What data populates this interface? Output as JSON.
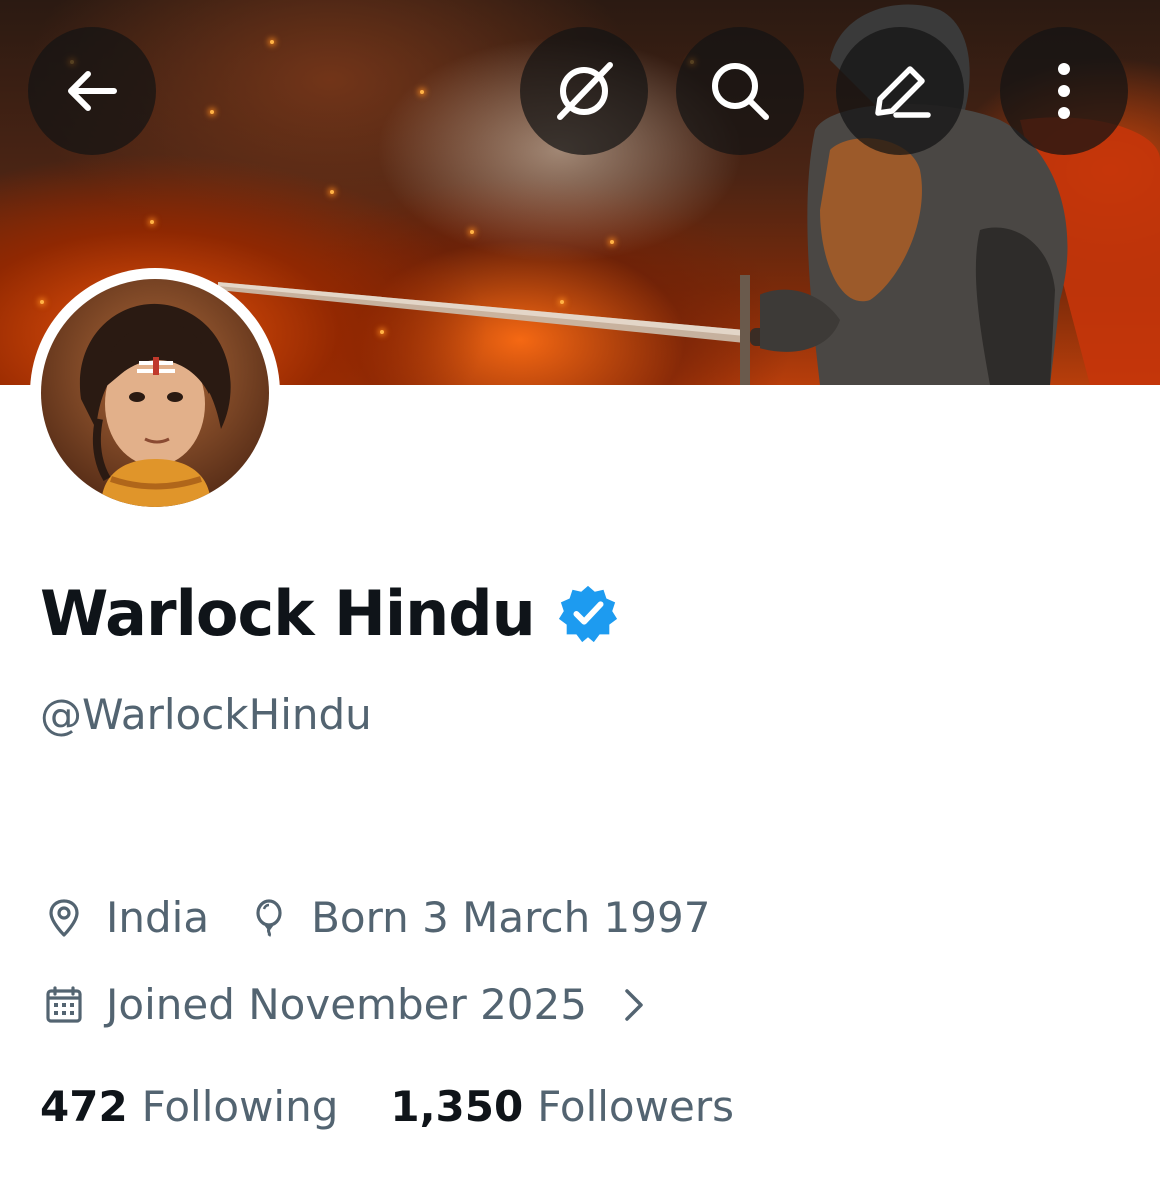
{
  "profile": {
    "display_name": "Warlock Hindu",
    "handle": "@WarlockHindu",
    "verified_icon": "verified-badge-icon",
    "location": "India",
    "birthday": "Born 3 March 1997",
    "joined": "Joined November 2025",
    "following_count": "472",
    "following_label": "Following",
    "followers_count": "1,350",
    "followers_label": "Followers"
  },
  "header": {
    "buttons": [
      "back-arrow-icon",
      "grok-icon",
      "search-icon",
      "edit-icon",
      "more-vertical-icon"
    ]
  },
  "colors": {
    "text_primary": "#0f1419",
    "text_secondary": "#536471",
    "verified_blue": "#1d9bf0",
    "button_bg": "#141414"
  }
}
